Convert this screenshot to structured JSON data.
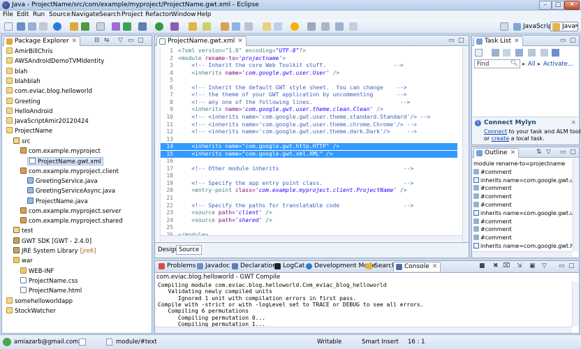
{
  "window": {
    "title": "Java - ProjectName/src/com/example/myproject/ProjectName.gwt.xml - Eclipse",
    "minimize": "–",
    "maximize": "□",
    "close": "✕"
  },
  "menu": [
    "File",
    "Edit",
    "Run",
    "Source",
    "Navigate",
    "Search",
    "Project",
    "Refactor",
    "Window",
    "Help"
  ],
  "perspectives": {
    "javascript": "JavaScript",
    "java": "Java",
    "more": "»"
  },
  "package_explorer": {
    "tab": "Package Explorer",
    "items": [
      {
        "label": "AmirBillChris",
        "icon": "proj"
      },
      {
        "label": "AWSAndroidDemoTVMIdentity",
        "icon": "proj"
      },
      {
        "label": "blah",
        "icon": "proj"
      },
      {
        "label": "blahblah",
        "icon": "proj"
      },
      {
        "label": "com.eviac.blog.helloworld",
        "icon": "proj"
      },
      {
        "label": "Greeting",
        "icon": "proj"
      },
      {
        "label": "HelloAndroid",
        "icon": "proj"
      },
      {
        "label": "JavaScriptAmir20120424",
        "icon": "proj"
      },
      {
        "label": "ProjectName",
        "icon": "proj"
      },
      {
        "label": "src",
        "icon": "pkgroot"
      },
      {
        "label": "com.example.myproject",
        "icon": "pkg"
      },
      {
        "label": "ProjectName.gwt.xml",
        "icon": "xmlf"
      },
      {
        "label": "com.example.myproject.client",
        "icon": "pkg"
      },
      {
        "label": "GreetingService.java",
        "icon": "javaf"
      },
      {
        "label": "GreetingServiceAsync.java",
        "icon": "javaf"
      },
      {
        "label": "ProjectName.java",
        "icon": "javaf"
      },
      {
        "label": "com.example.myproject.server",
        "icon": "pkg"
      },
      {
        "label": "com.example.myproject.shared",
        "icon": "pkg"
      },
      {
        "label": "test",
        "icon": "pkgroot"
      },
      {
        "label": "GWT SDK [GWT - 2.4.0]",
        "icon": "lib"
      },
      {
        "label": "JRE System Library",
        "icon": "lib",
        "suffix": "[jre6]"
      },
      {
        "label": "war",
        "icon": "folder"
      },
      {
        "label": "WEB-INF",
        "icon": "folder"
      },
      {
        "label": "ProjectName.css",
        "icon": "xmlf"
      },
      {
        "label": "ProjectName.html",
        "icon": "xmlf"
      },
      {
        "label": "somehelloworldapp",
        "icon": "proj"
      },
      {
        "label": "StockWatcher",
        "icon": "proj"
      }
    ]
  },
  "editor": {
    "tab": "ProjectName.gwt.xml",
    "lines": [
      {
        "n": "1",
        "segs": [
          {
            "c": "tag",
            "t": "<?xml version=\"1.0\" encoding="
          },
          {
            "c": "val",
            "t": "\"UTF-8\""
          },
          {
            "c": "tag",
            "t": "?>"
          }
        ]
      },
      {
        "n": "2",
        "segs": [
          {
            "c": "tag",
            "t": "<module "
          },
          {
            "c": "attr",
            "t": "rename-to="
          },
          {
            "c": "val",
            "t": "'projectname'"
          },
          {
            "c": "tag",
            "t": ">"
          }
        ]
      },
      {
        "n": "3",
        "segs": [
          {
            "c": "comment",
            "t": "    <!-- Inherit the core Web Toolkit stuff.                    -->"
          }
        ]
      },
      {
        "n": "4",
        "segs": [
          {
            "c": "tag",
            "t": "    <inherits "
          },
          {
            "c": "attr",
            "t": "name="
          },
          {
            "c": "val",
            "t": "'com.google.gwt.user.User'"
          },
          {
            "c": "tag",
            "t": " />"
          }
        ]
      },
      {
        "n": "5",
        "segs": [
          {
            "c": "tag",
            "t": ""
          }
        ]
      },
      {
        "n": "6",
        "segs": [
          {
            "c": "comment",
            "t": "    <!-- Inherit the default GWT style sheet.  You can change    -->"
          }
        ]
      },
      {
        "n": "7",
        "segs": [
          {
            "c": "comment",
            "t": "    <!-- the theme of your GWT application by uncommenting       -->"
          }
        ]
      },
      {
        "n": "8",
        "segs": [
          {
            "c": "comment",
            "t": "    <!-- any one of the following lines.                          -->"
          }
        ]
      },
      {
        "n": "9",
        "segs": [
          {
            "c": "tag",
            "t": "    <inherits "
          },
          {
            "c": "attr",
            "t": "name="
          },
          {
            "c": "val",
            "t": "'com.google.gwt.user.theme.clean.Clean'"
          },
          {
            "c": "tag",
            "t": " />"
          }
        ]
      },
      {
        "n": "10",
        "segs": [
          {
            "c": "comment",
            "t": "    <!-- <inherits name='com.google.gwt.user.theme.standard.Standard'/> -->"
          }
        ]
      },
      {
        "n": "11",
        "segs": [
          {
            "c": "comment",
            "t": "    <!-- <inherits name='com.google.gwt.user.theme.chrome.Chrome'/> -->"
          }
        ]
      },
      {
        "n": "12",
        "segs": [
          {
            "c": "comment",
            "t": "    <!-- <inherits name='com.google.gwt.user.theme.dark.Dark'/>     -->"
          }
        ]
      },
      {
        "n": "13",
        "segs": [
          {
            "c": "tag",
            "t": ""
          }
        ]
      },
      {
        "n": "14",
        "hl": true,
        "segs": [
          {
            "c": "plain",
            "t": "    <inherits name=\"com.google.gwt.http.HTTP\" />"
          }
        ]
      },
      {
        "n": "15",
        "hl": true,
        "segs": [
          {
            "c": "plain",
            "t": "    <inherits name=\"com.google.gwt.xml.XML\" />"
          }
        ]
      },
      {
        "n": "16",
        "segs": [
          {
            "c": "tag",
            "t": ""
          }
        ]
      },
      {
        "n": "17",
        "segs": [
          {
            "c": "comment",
            "t": "    <!-- Other module inherits                                     -->"
          }
        ]
      },
      {
        "n": "18",
        "segs": [
          {
            "c": "tag",
            "t": ""
          }
        ]
      },
      {
        "n": "19",
        "segs": [
          {
            "c": "comment",
            "t": "    <!-- Specify the app entry point class.                        -->"
          }
        ]
      },
      {
        "n": "20",
        "segs": [
          {
            "c": "tag",
            "t": "    <entry-point "
          },
          {
            "c": "attr",
            "t": "class="
          },
          {
            "c": "val",
            "t": "'com.example.myproject.client.ProjectName'"
          },
          {
            "c": "tag",
            "t": " />"
          }
        ]
      },
      {
        "n": "21",
        "segs": [
          {
            "c": "tag",
            "t": ""
          }
        ]
      },
      {
        "n": "22",
        "segs": [
          {
            "c": "comment",
            "t": "    <!-- Specify the paths for translatable code                   -->"
          }
        ]
      },
      {
        "n": "23",
        "segs": [
          {
            "c": "tag",
            "t": "    <source "
          },
          {
            "c": "attr",
            "t": "path="
          },
          {
            "c": "val",
            "t": "'client'"
          },
          {
            "c": "tag",
            "t": " />"
          }
        ]
      },
      {
        "n": "24",
        "segs": [
          {
            "c": "tag",
            "t": "    <source "
          },
          {
            "c": "attr",
            "t": "path="
          },
          {
            "c": "val",
            "t": "'shared'"
          },
          {
            "c": "tag",
            "t": " />"
          }
        ]
      },
      {
        "n": "25",
        "segs": [
          {
            "c": "tag",
            "t": ""
          }
        ]
      },
      {
        "n": "26",
        "segs": [
          {
            "c": "tag",
            "t": "</module>"
          }
        ]
      }
    ],
    "bottom_tabs": [
      "Design",
      "Source"
    ]
  },
  "task_list": {
    "tab": "Task List",
    "find_placeholder": "Find",
    "all": "All",
    "activate": "Activate...",
    "mylyn_title": "Connect Mylyn",
    "mylyn_link1": "Connect",
    "mylyn_text1": " to your task and ALM tools",
    "mylyn_text2": "or ",
    "mylyn_link2": "create",
    "mylyn_text3": " a local task."
  },
  "outline": {
    "tab": "Outline",
    "items": [
      {
        "label": "module rename-to=projectname",
        "icon": "none"
      },
      {
        "label": "#comment",
        "icon": "comment"
      },
      {
        "label": "inherits name=com.google.gwt.user.",
        "icon": "elem"
      },
      {
        "label": "#comment",
        "icon": "comment"
      },
      {
        "label": "#comment",
        "icon": "comment"
      },
      {
        "label": "#comment",
        "icon": "comment"
      },
      {
        "label": "inherits name=com.google.gwt.user.",
        "icon": "elem"
      },
      {
        "label": "#comment",
        "icon": "comment"
      },
      {
        "label": "#comment",
        "icon": "comment"
      },
      {
        "label": "#comment",
        "icon": "comment"
      },
      {
        "label": "inherits name=com.google.gwt.http.",
        "icon": "elem"
      }
    ]
  },
  "console": {
    "tabs": [
      "Problems",
      "Javadoc",
      "Declaration",
      "LogCat",
      "Development Mode",
      "Search",
      "Console"
    ],
    "header": "com.eviac.blog.helloworld - GWT Compile",
    "lines": [
      "Compiling module com.eviac.blog.helloworld.Com_eviac_blog_helloworld",
      "   Validating newly compiled units",
      "      Ignored 1 unit with compilation errors in first pass.",
      "Compile with -strict or with -logLevel set to TRACE or DEBUG to see all errors.",
      "   Compiling 6 permutations",
      "      Compiling permutation 0...",
      "      Compiling permutation 1..."
    ]
  },
  "status": {
    "user": "amiazarb@gmail.com",
    "path": "module/#text",
    "writable": "Writable",
    "insert": "Smart Insert",
    "position": "16 : 1"
  }
}
